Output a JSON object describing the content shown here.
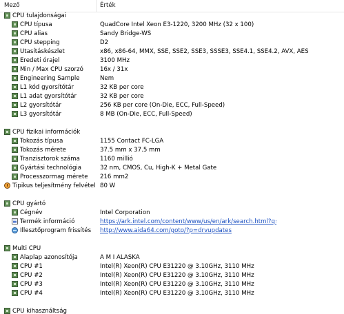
{
  "header": {
    "field": "Mező",
    "value": "Érték"
  },
  "sections": [
    {
      "title": "CPU tulajdonságai",
      "items": [
        {
          "label": "CPU típusa",
          "value": "QuadCore Intel Xeon E3-1220, 3200 MHz (32 x 100)"
        },
        {
          "label": "CPU alias",
          "value": "Sandy Bridge-WS"
        },
        {
          "label": "CPU stepping",
          "value": "D2"
        },
        {
          "label": "Utasításkészlet",
          "value": "x86, x86-64, MMX, SSE, SSE2, SSE3, SSSE3, SSE4.1, SSE4.2, AVX, AES"
        },
        {
          "label": "Eredeti órajel",
          "value": "3100 MHz"
        },
        {
          "label": "Min / Max CPU szorzó",
          "value": "16x / 31x"
        },
        {
          "label": "Engineering Sample",
          "value": "Nem"
        },
        {
          "label": "L1 kód gyorsítótár",
          "value": "32 KB per core"
        },
        {
          "label": "L1 adat gyorsítótár",
          "value": "32 KB per core"
        },
        {
          "label": "L2 gyorsítótár",
          "value": "256 KB per core  (On-Die, ECC, Full-Speed)"
        },
        {
          "label": "L3 gyorsítótár",
          "value": "8 MB  (On-Die, ECC, Full-Speed)"
        }
      ]
    },
    {
      "title": "CPU fizikai információk",
      "items": [
        {
          "label": "Tokozás típusa",
          "value": "1155 Contact FC-LGA"
        },
        {
          "label": "Tokozás mérete",
          "value": "37.5 mm x 37.5 mm"
        },
        {
          "label": "Tranzisztorok száma",
          "value": "1160 millió"
        },
        {
          "label": "Gyártási technológia",
          "value": "32 nm, CMOS, Cu, High-K + Metal Gate"
        },
        {
          "label": "Processzormag mérete",
          "value": "216 mm2"
        },
        {
          "label": "Tipikus teljesítmény felvétel",
          "value": "80 W"
        }
      ]
    },
    {
      "title": "CPU gyártó",
      "items": [
        {
          "label": "Cégnév",
          "value": "Intel Corporation"
        },
        {
          "label": "Termék információ",
          "value": "https://ark.intel.com/content/www/us/en/ark/search.html?q=Intel%..."
        },
        {
          "label": "Illesztőprogram frissítés",
          "value": "http://www.aida64.com/goto/?p=drvupdates"
        }
      ]
    },
    {
      "title": "Multi CPU",
      "items": [
        {
          "label": "Alaplap azonosítója",
          "value": "A M I ALASKA"
        },
        {
          "label": "CPU #1",
          "value": "Intel(R) Xeon(R) CPU E31220 @ 3.10GHz, 3110 MHz"
        },
        {
          "label": "CPU #2",
          "value": "Intel(R) Xeon(R) CPU E31220 @ 3.10GHz, 3110 MHz"
        },
        {
          "label": "CPU #3",
          "value": "Intel(R) Xeon(R) CPU E31220 @ 3.10GHz, 3110 MHz"
        },
        {
          "label": "CPU #4",
          "value": "Intel(R) Xeon(R) CPU E31220 @ 3.10GHz, 3110 MHz"
        }
      ]
    },
    {
      "title": "CPU kihasználtság",
      "items": []
    }
  ],
  "colors": {
    "link": "#1a4fc0",
    "icon_green": "#5f8d54",
    "header_border": "#e5e5e5"
  },
  "icons": {
    "category": "chip-icon",
    "item": "chip-icon",
    "power": "power-gauge-icon",
    "product_info": "info-icon",
    "driver_update": "globe-icon"
  }
}
